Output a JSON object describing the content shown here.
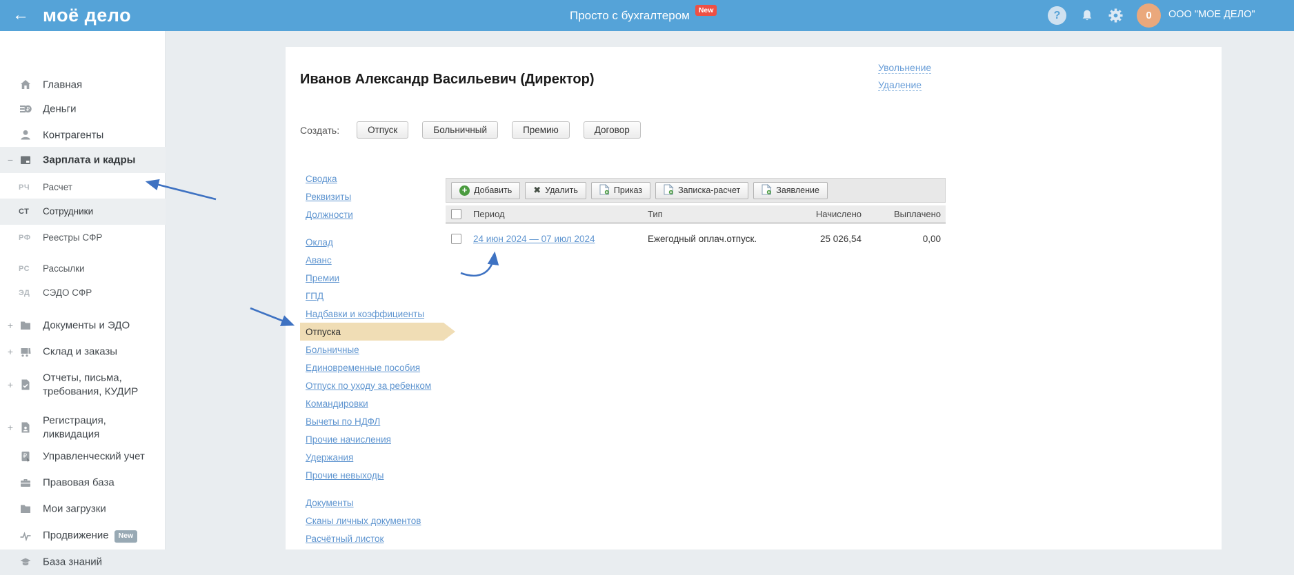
{
  "header": {
    "logo": "моё дело",
    "back_arrow": "←",
    "tagline": "Просто с бухгалтером",
    "tagline_badge": "New",
    "help_glyph": "?",
    "avatar_text": "0",
    "account": "ООО \"МОЕ ДЕЛО\""
  },
  "sidebar": {
    "items": [
      {
        "label": "Главная",
        "icon": "home"
      },
      {
        "label": "Деньги",
        "icon": "money"
      },
      {
        "label": "Контрагенты",
        "icon": "person"
      },
      {
        "label": "Зарплата и кадры",
        "icon": "wallet",
        "expander": "−"
      },
      {
        "label": "Расчет",
        "code": "РЧ"
      },
      {
        "label": "Сотрудники",
        "code": "СТ"
      },
      {
        "label": "Реестры СФР",
        "code": "РФ"
      },
      {
        "label": "Рассылки",
        "code": "РС"
      },
      {
        "label": "СЭДО СФР",
        "code": "ЭД"
      },
      {
        "label": "Документы и ЭДО",
        "icon": "folder",
        "expander": "+"
      },
      {
        "label": "Склад и заказы",
        "icon": "cart",
        "expander": "+"
      },
      {
        "label": "Отчеты, письма, требования, КУДИР",
        "icon": "doc-check",
        "expander": "+"
      },
      {
        "label": "Регистрация, ликвидация",
        "icon": "doc-person",
        "expander": "+"
      },
      {
        "label": "Управленческий учет",
        "icon": "ruble-card"
      },
      {
        "label": "Правовая база",
        "icon": "briefcase"
      },
      {
        "label": "Мои загрузки",
        "icon": "folder"
      },
      {
        "label": "Продвижение",
        "icon": "pulse",
        "badge": "New"
      },
      {
        "label": "База знаний",
        "icon": "graduation-cap"
      }
    ]
  },
  "main": {
    "title": "Иванов Александр Васильевич (Директор)",
    "actions": [
      {
        "label": "Увольнение"
      },
      {
        "label": "Удаление"
      }
    ],
    "create": {
      "label": "Создать:",
      "buttons": [
        "Отпуск",
        "Больничный",
        "Премию",
        "Договор"
      ]
    },
    "subnav": {
      "groups": [
        [
          "Сводка",
          "Реквизиты",
          "Должности"
        ],
        [
          "Оклад",
          "Аванс",
          "Премии",
          "ГПД",
          "Надбавки и коэффициенты",
          "Отпуска",
          "Больничные",
          "Единовременные пособия",
          "Отпуск по уходу за ребенком",
          "Командировки",
          "Вычеты по НДФЛ",
          "Прочие начисления",
          "Удержания",
          "Прочие невыходы"
        ],
        [
          "Документы",
          "Сканы личных документов",
          "Расчётный листок"
        ]
      ],
      "active": "Отпуска"
    },
    "toolbar": {
      "buttons": [
        "Добавить",
        "Удалить",
        "Приказ",
        "Записка-расчет",
        "Заявление"
      ]
    },
    "table": {
      "columns": [
        "Период",
        "Тип",
        "Начислено",
        "Выплачено"
      ],
      "rows": [
        {
          "period": "24 июн 2024 — 07 июл 2024",
          "type": "Ежегодный оплач.отпуск.",
          "accrued": "25 026,54",
          "paid": "0,00"
        }
      ]
    }
  },
  "colors": {
    "topbar_blue": "#55a3d8",
    "badge_red": "#ee5044",
    "link_blue": "#5f95d0",
    "active_ribbon_tan": "#f0ddb5",
    "annotation_arrow_blue": "#3e72c2",
    "avatar_orange": "#eaa87c",
    "add_button_green": "#4a9b3f",
    "sidebar_highlight": "#eceff1"
  }
}
